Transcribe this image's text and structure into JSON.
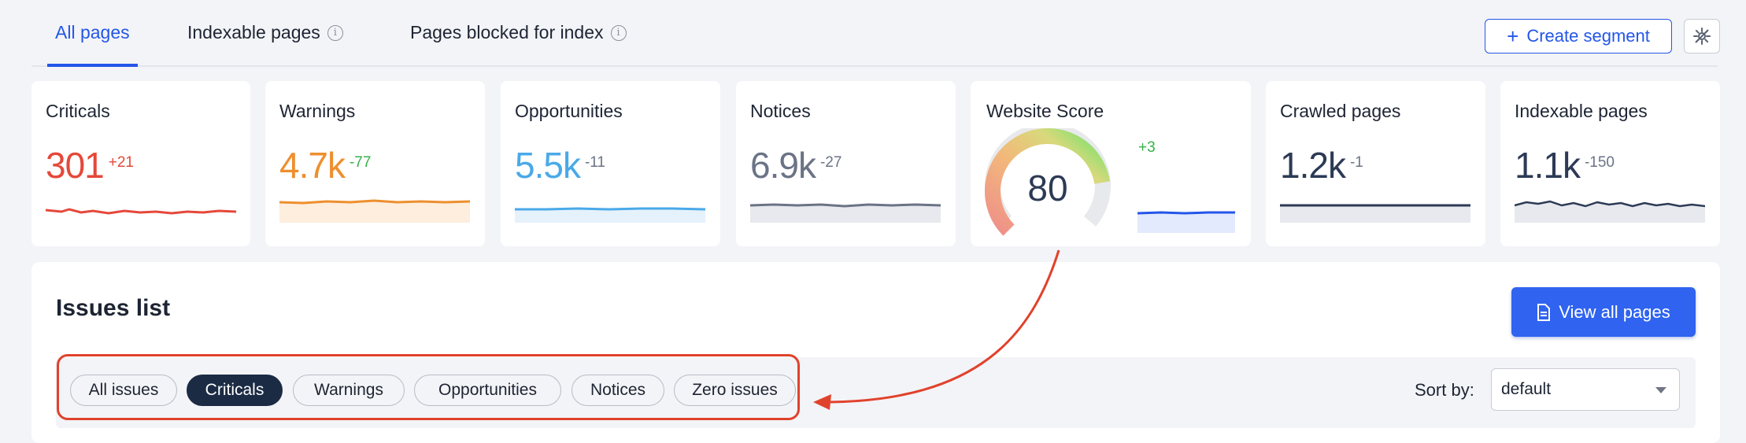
{
  "tabs": [
    {
      "label": "All pages",
      "active": true
    },
    {
      "label": "Indexable pages",
      "info": true
    },
    {
      "label": "Pages blocked for index",
      "info": true
    }
  ],
  "info_glyph": "i",
  "toolbar": {
    "create_segment_label": "Create segment",
    "create_plus": "+",
    "settings_icon": "settings-icon"
  },
  "colors": {
    "accent": "#2456e8",
    "critical": "#e5483a",
    "warning": "#ee8f2e",
    "opportunity": "#4aa9e8",
    "notice": "#6b7386",
    "dark": "#2c3a55",
    "positive": "#34b24a",
    "annotation": "#e0422c"
  },
  "cards": {
    "criticals": {
      "label": "Criticals",
      "value": "301",
      "delta": "+21"
    },
    "warnings": {
      "label": "Warnings",
      "value": "4.7k",
      "delta": "-77"
    },
    "opportunities": {
      "label": "Opportunities",
      "value": "5.5k",
      "delta": "-11"
    },
    "notices": {
      "label": "Notices",
      "value": "6.9k",
      "delta": "-27"
    },
    "score": {
      "label": "Website Score",
      "value": "80",
      "delta": "+3",
      "gauge_fraction": 0.8
    },
    "crawled": {
      "label": "Crawled pages",
      "value": "1.2k",
      "delta": "-1"
    },
    "indexable": {
      "label": "Indexable pages",
      "value": "1.1k",
      "delta": "-150"
    }
  },
  "issues": {
    "title": "Issues list",
    "view_all_label": "View all pages",
    "filters": [
      "All issues",
      "Criticals",
      "Warnings",
      "Opportunities",
      "Notices",
      "Zero issues"
    ],
    "active_filter": "Criticals",
    "sort_label": "Sort by:",
    "sort_value": "default"
  }
}
